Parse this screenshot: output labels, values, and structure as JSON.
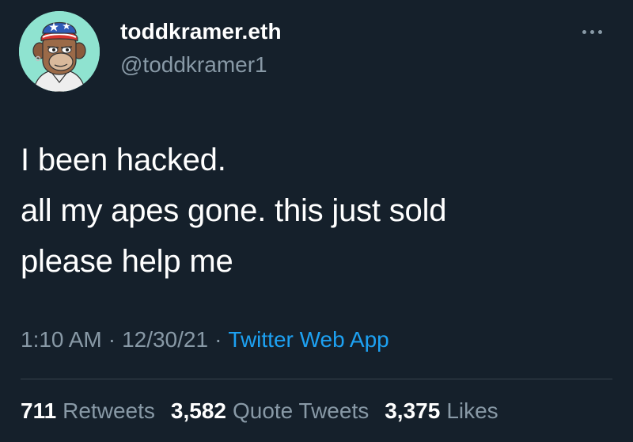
{
  "author": {
    "display_name": "toddkramer.eth",
    "handle": "@toddkramer1",
    "avatar_icon": "bored-ape-avatar-icon"
  },
  "more_icon": "more-horizontal-icon",
  "tweet": {
    "lines": [
      "I been hacked.",
      "all my apes gone. this just sold",
      "please help me"
    ]
  },
  "meta": {
    "time": "1:10 AM",
    "separator": "·",
    "date": "12/30/21",
    "source": "Twitter Web App"
  },
  "stats": {
    "retweets": {
      "count": "711",
      "label": "Retweets"
    },
    "quote_tweets": {
      "count": "3,582",
      "label": "Quote Tweets"
    },
    "likes": {
      "count": "3,375",
      "label": "Likes"
    }
  },
  "colors": {
    "background": "#15202b",
    "primary_text": "#ffffff",
    "secondary_text": "#8899a6",
    "link": "#1da1f2",
    "divider": "#38444d"
  }
}
